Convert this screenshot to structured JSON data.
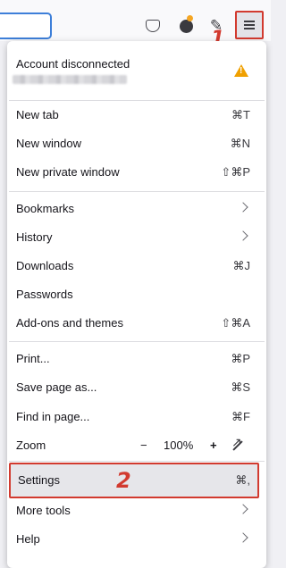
{
  "toolbar": {
    "icons": [
      "pocket-icon",
      "account-icon",
      "extensions-icon",
      "menu-icon"
    ],
    "annotation_1": "1",
    "accent": "#d23a2f"
  },
  "account": {
    "title": "Account disconnected",
    "warning_color": "#f0a000"
  },
  "menu": {
    "new_tab": {
      "label": "New tab",
      "shortcut": "⌘T"
    },
    "new_window": {
      "label": "New window",
      "shortcut": "⌘N"
    },
    "new_private_window": {
      "label": "New private window",
      "shortcut": "⇧⌘P"
    },
    "bookmarks": {
      "label": "Bookmarks"
    },
    "history": {
      "label": "History"
    },
    "downloads": {
      "label": "Downloads",
      "shortcut": "⌘J"
    },
    "passwords": {
      "label": "Passwords"
    },
    "addons": {
      "label": "Add-ons and themes",
      "shortcut": "⇧⌘A"
    },
    "print": {
      "label": "Print...",
      "shortcut": "⌘P"
    },
    "save_page": {
      "label": "Save page as...",
      "shortcut": "⌘S"
    },
    "find": {
      "label": "Find in page...",
      "shortcut": "⌘F"
    },
    "zoom": {
      "label": "Zoom",
      "minus": "−",
      "value": "100%",
      "plus": "+"
    },
    "settings": {
      "label": "Settings",
      "shortcut": "⌘,"
    },
    "more_tools": {
      "label": "More tools"
    },
    "help": {
      "label": "Help"
    }
  },
  "annotation_2": "2"
}
